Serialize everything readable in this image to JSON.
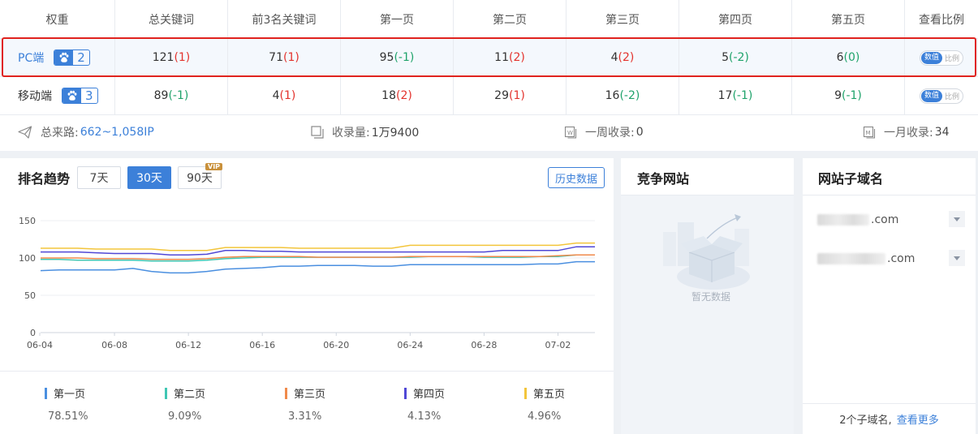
{
  "table": {
    "headers": [
      "权重",
      "总关键词",
      "前3名关键词",
      "第一页",
      "第二页",
      "第三页",
      "第四页",
      "第五页",
      "查看比例"
    ],
    "rows": [
      {
        "platform": "PC端",
        "weight": "2",
        "cells": [
          {
            "value": "121",
            "change": "(1)"
          },
          {
            "value": "71",
            "change": "(1)"
          },
          {
            "value": "95",
            "change": "(-1)"
          },
          {
            "value": "11",
            "change": "(2)"
          },
          {
            "value": "4",
            "change": "(2)"
          },
          {
            "value": "5",
            "change": "(-2)"
          },
          {
            "value": "6",
            "change": "(0)"
          }
        ]
      },
      {
        "platform": "移动端",
        "weight": "3",
        "cells": [
          {
            "value": "89",
            "change": "(-1)"
          },
          {
            "value": "4",
            "change": "(1)"
          },
          {
            "value": "18",
            "change": "(2)"
          },
          {
            "value": "29",
            "change": "(1)"
          },
          {
            "value": "16",
            "change": "(-2)"
          },
          {
            "value": "17",
            "change": "(-1)"
          },
          {
            "value": "9",
            "change": "(-1)"
          }
        ]
      }
    ],
    "toggle": {
      "on": "数值",
      "off": "比例"
    }
  },
  "summary": {
    "traffic_label": "总来路:",
    "traffic_value": "662~1,058IP",
    "indexed_label": "收录量:",
    "indexed_value": "1万9400",
    "week_label": "一周收录:",
    "week_value": "0",
    "month_label": "一月收录:",
    "month_value": "34"
  },
  "trend": {
    "title": "排名趋势",
    "ranges": [
      "7天",
      "30天",
      "90天"
    ],
    "active_range": "30天",
    "vip_badge": "VIP",
    "history_button": "历史数据"
  },
  "chart_data": {
    "type": "line",
    "x": [
      "06-04",
      "06-05",
      "06-06",
      "06-07",
      "06-08",
      "06-09",
      "06-10",
      "06-11",
      "06-12",
      "06-13",
      "06-14",
      "06-15",
      "06-16",
      "06-17",
      "06-18",
      "06-19",
      "06-20",
      "06-21",
      "06-22",
      "06-23",
      "06-24",
      "06-25",
      "06-26",
      "06-27",
      "06-28",
      "06-29",
      "06-30",
      "07-01",
      "07-02",
      "07-03",
      "07-04"
    ],
    "xticks": [
      "06-04",
      "06-08",
      "06-12",
      "06-16",
      "06-20",
      "06-24",
      "06-28",
      "07-02"
    ],
    "ylim": [
      0,
      150
    ],
    "yticks": [
      0,
      50,
      100,
      150
    ],
    "grid": true,
    "series": [
      {
        "name": "第一页",
        "color": "#4a8fe0",
        "values": [
          83,
          84,
          84,
          84,
          84,
          86,
          82,
          80,
          80,
          82,
          85,
          86,
          87,
          89,
          89,
          90,
          90,
          90,
          89,
          89,
          91,
          91,
          91,
          91,
          91,
          91,
          91,
          92,
          92,
          95,
          95
        ]
      },
      {
        "name": "第二页",
        "color": "#3fc7b4",
        "values": [
          98,
          98,
          97,
          97,
          97,
          97,
          96,
          96,
          96,
          97,
          99,
          100,
          101,
          101,
          101,
          101,
          101,
          101,
          101,
          101,
          101,
          102,
          102,
          102,
          101,
          101,
          101,
          102,
          102,
          104,
          104
        ]
      },
      {
        "name": "第三页",
        "color": "#f08a4b",
        "values": [
          100,
          100,
          100,
          99,
          99,
          99,
          98,
          98,
          98,
          99,
          101,
          102,
          102,
          102,
          102,
          101,
          101,
          101,
          101,
          101,
          102,
          102,
          102,
          102,
          102,
          102,
          102,
          102,
          103,
          104,
          104
        ]
      },
      {
        "name": "第四页",
        "color": "#5048d6",
        "values": [
          108,
          108,
          108,
          107,
          106,
          106,
          106,
          104,
          104,
          105,
          110,
          110,
          109,
          109,
          108,
          108,
          108,
          108,
          108,
          108,
          108,
          108,
          108,
          108,
          108,
          110,
          110,
          110,
          110,
          115,
          115
        ]
      },
      {
        "name": "第五页",
        "color": "#f3c53b",
        "values": [
          113,
          113,
          113,
          112,
          112,
          112,
          112,
          110,
          110,
          110,
          114,
          114,
          114,
          114,
          113,
          113,
          113,
          113,
          113,
          113,
          117,
          117,
          117,
          117,
          117,
          117,
          117,
          117,
          117,
          120,
          120
        ]
      }
    ],
    "legend_percents": [
      "78.51%",
      "9.09%",
      "3.31%",
      "4.13%",
      "4.96%"
    ]
  },
  "competitors": {
    "title": "竞争网站",
    "empty": "暂无数据"
  },
  "subdomains": {
    "title": "网站子域名",
    "items": [
      ".com",
      ".com"
    ],
    "footer_count": "2个子域名,",
    "footer_more": "查看更多"
  },
  "colors": {
    "accent": "#3c80d9",
    "up": "#e3332d",
    "down": "#1fa36b",
    "highlight": "#e0231e"
  }
}
